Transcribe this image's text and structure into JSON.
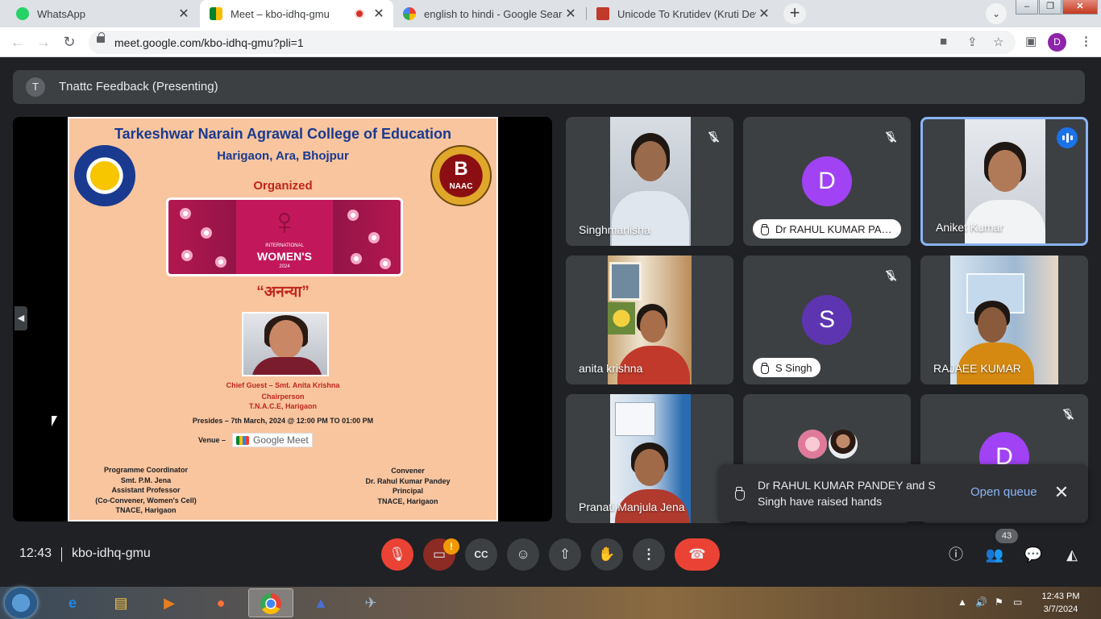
{
  "browser": {
    "tabs": [
      {
        "title": "WhatsApp",
        "icon": "whatsapp-icon",
        "color": "#25d366"
      },
      {
        "title": "Meet – kbo-idhq-gmu",
        "icon": "meet-icon",
        "color": "#00832d"
      },
      {
        "title": "english to hindi - Google Search",
        "icon": "google-icon",
        "color": "#4285f4"
      },
      {
        "title": "Unicode To Krutidev (Kruti Dev) C",
        "icon": "kju-icon",
        "color": "#c0392b"
      }
    ],
    "url": "meet.google.com/kbo-idhq-gmu?pli=1",
    "profile_initial": "D"
  },
  "meet": {
    "presenting_avatar": "T",
    "presenting_title": "Tnattc Feedback (Presenting)",
    "poster": {
      "title": "Tarkeshwar Narain Agrawal College of Education",
      "subtitle": "Harigaon, Ara, Bhojpur",
      "organized": "Organized",
      "naac_grade": "B",
      "naac_label": "NAAC",
      "banner_small": "INTERNATIONAL",
      "banner_big": "WOMEN'S",
      "banner_year": "2024",
      "hindi_title": "“अनन्या”",
      "chief_guest": "Chief Guest – Smt. Anita Krishna",
      "chief_role": "Chairperson",
      "chief_org": "T.N.A.C.E, Harigaon",
      "presides": "Presides – 7th March, 2024 @ 12:00 PM TO 01:00 PM",
      "venue_label": "Venue –",
      "venue_value": "Google Meet",
      "coordinator": [
        "Programme Coordinator",
        "Smt. P.M. Jena",
        "Assistant Professor",
        "(Co-Convener, Women's Cell)",
        "TNACE, Harigaon"
      ],
      "convener": [
        "Convener",
        "Dr. Rahul Kumar Pandey",
        "Principal",
        "TNACE, Harigaon"
      ]
    },
    "participants": [
      {
        "name": "Singhmanisha",
        "muted": true
      },
      {
        "name": "Dr RAHUL KUMAR PAN...",
        "avatar": "D",
        "avatar_color": "#a142f4",
        "hand_raised": true,
        "muted": true
      },
      {
        "name": "Aniket Kumar",
        "speaking": true
      },
      {
        "name": "anita krishna"
      },
      {
        "name": "S Singh",
        "avatar": "S",
        "avatar_color": "#5e35b1",
        "hand_raised": true,
        "muted": true
      },
      {
        "name": "RAJAEE KUMAR"
      },
      {
        "name": "Pranati Manjula Jena"
      },
      {
        "name": ""
      },
      {
        "name": "",
        "avatar": "D",
        "avatar_color": "#a142f4",
        "muted": true
      }
    ],
    "toast": {
      "text": "Dr RAHUL KUMAR PANDEY and S Singh have raised hands",
      "action": "Open queue"
    },
    "clock": "12:43",
    "meeting_code": "kbo-idhq-gmu",
    "warning_badge": "!",
    "people_count": "43"
  },
  "taskbar": {
    "time": "12:43 PM",
    "date": "3/7/2024"
  }
}
